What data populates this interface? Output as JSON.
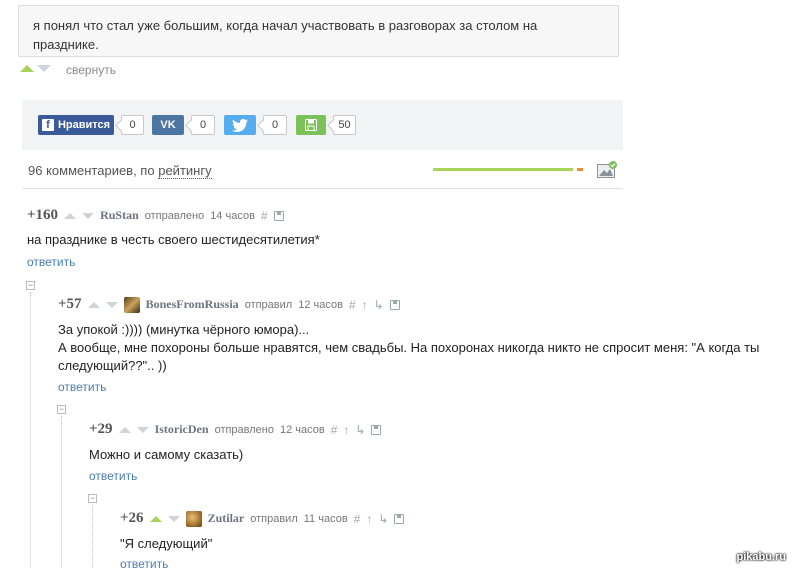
{
  "post": {
    "text": "я понял что стал уже большим, когда начал участвовать в разговорах за столом на празднике.",
    "collapse_label": "свернуть"
  },
  "share": {
    "facebook_label": "Нравится",
    "facebook_count": "0",
    "vk_label": "VK",
    "vk_count": "0",
    "twitter_count": "0",
    "save_count": "50"
  },
  "comments_header": {
    "count_text": "96 комментариев, по",
    "sort_label": "рейтингу",
    "rating_bar": {
      "positive": 0.96,
      "negative": 0.04
    },
    "colors": {
      "positive": "#a7d35a",
      "negative": "#f28b2c"
    }
  },
  "comments": [
    {
      "rating": "+160",
      "nick": "RuStan",
      "action": "отправлено",
      "time": "14 часов",
      "text": "на празднике в честь своего шестидесятилетия*",
      "reply": "ответить"
    },
    {
      "rating": "+57",
      "nick": "BonesFromRussia",
      "action": "отправил",
      "time": "12 часов",
      "text_line1": "За упокой :)))) (минутка чёрного юмора)...",
      "text_line2": "А вообще, мне похороны больше нравятся, чем свадьбы. На похоронах никогда никто не спросит меня: \"А когда ты",
      "text_line3": "следующий??\".. ))",
      "reply": "ответить"
    },
    {
      "rating": "+29",
      "nick": "IstoricDen",
      "action": "отправлено",
      "time": "12 часов",
      "text": "Можно и самому сказать)",
      "reply": "ответить"
    },
    {
      "rating": "+26",
      "nick": "Zutilar",
      "action": "отправил",
      "time": "11 часов",
      "text": "\"Я следующий\"",
      "reply": "ответить"
    }
  ],
  "icons": {
    "hash": "#",
    "up_thread": "↑",
    "branch": "↳",
    "collapse": "−"
  },
  "watermark": "pikabu.ru"
}
